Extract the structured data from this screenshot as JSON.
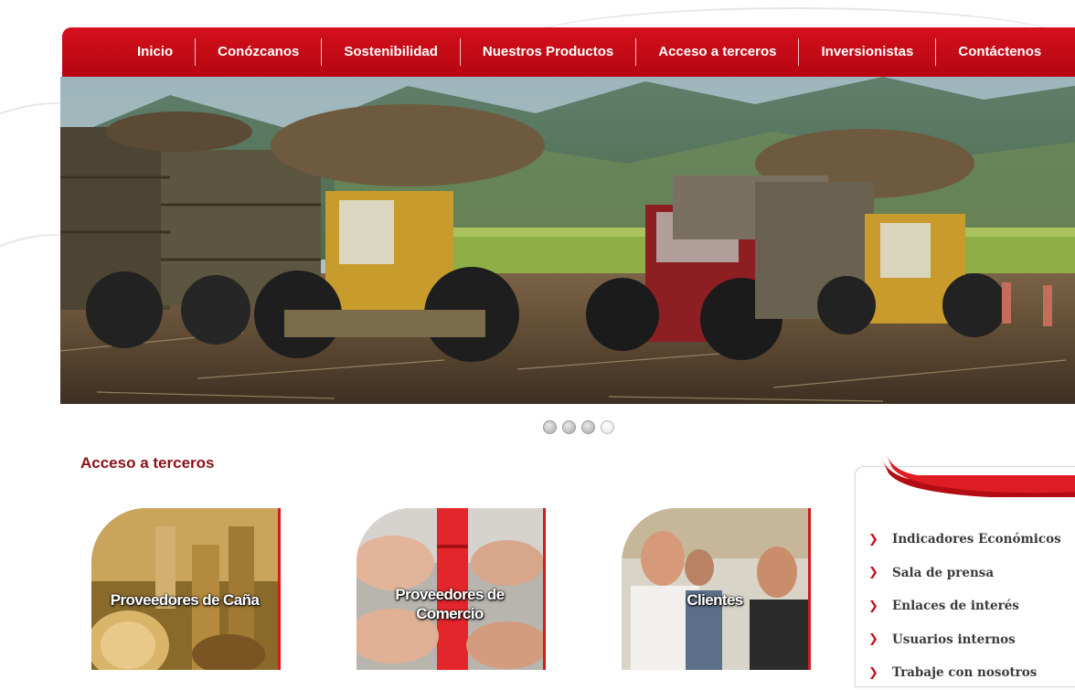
{
  "nav": {
    "items": [
      {
        "label": "Inicio"
      },
      {
        "label": "Conózcanos"
      },
      {
        "label": "Sostenibilidad"
      },
      {
        "label": "Nuestros Productos"
      },
      {
        "label": "Acceso a terceros"
      },
      {
        "label": "Inversionistas"
      },
      {
        "label": "Contáctenos"
      }
    ]
  },
  "slider": {
    "dot_count": 4,
    "active_index": 3
  },
  "section": {
    "title": "Acceso a terceros"
  },
  "cards": [
    {
      "line1": "Proveedores de Caña",
      "line2": ""
    },
    {
      "line1": "Proveedores de",
      "line2": "Comercio"
    },
    {
      "line1": "Clientes",
      "line2": ""
    }
  ],
  "sidebar": {
    "items": [
      {
        "label": "Indicadores Económicos"
      },
      {
        "label": "Sala de prensa"
      },
      {
        "label": "Enlaces de interés"
      },
      {
        "label": "Usuarios internos"
      },
      {
        "label": "Trabaje con nosotros"
      }
    ]
  },
  "colors": {
    "brand_red": "#c20d17",
    "title_red": "#8b1017",
    "bullet_red": "#c1121b"
  }
}
